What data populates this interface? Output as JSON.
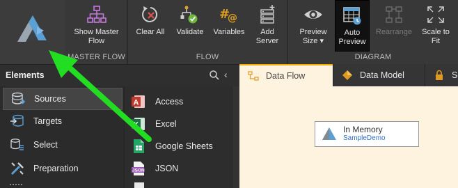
{
  "ribbon": {
    "master_flow": {
      "label": "MASTER FLOW",
      "show_master_flow": "Show Master Flow"
    },
    "flow": {
      "label": "FLOW",
      "clear_all": "Clear All",
      "validate": "Validate",
      "variables": "Variables",
      "add_server": "Add Server"
    },
    "diagram": {
      "label": "DIAGRAM",
      "preview_size": "Preview Size ▾",
      "auto_preview": "Auto Preview",
      "rearrange": "Rearrange",
      "scale_to_fit": "Scale to Fit"
    }
  },
  "elements_panel": {
    "title": "Elements",
    "categories": [
      {
        "label": "Sources",
        "icon": "database-icon",
        "selected": true
      },
      {
        "label": "Targets",
        "icon": "targets-icon"
      },
      {
        "label": "Select",
        "icon": "select-icon"
      },
      {
        "label": "Preparation",
        "icon": "preparation-icon"
      }
    ],
    "items": [
      {
        "label": "Access",
        "icon": "access-icon"
      },
      {
        "label": "Excel",
        "icon": "excel-icon"
      },
      {
        "label": "Google Sheets",
        "icon": "google-sheets-icon"
      },
      {
        "label": "JSON",
        "icon": "json-icon",
        "badge": "JSON"
      }
    ]
  },
  "tabs": [
    {
      "label": "Data Flow",
      "active": true
    },
    {
      "label": "Data Model"
    },
    {
      "label": "Se"
    }
  ],
  "canvas": {
    "node": {
      "title": "In Memory",
      "subtitle": "SampleDemo"
    }
  },
  "colors": {
    "accent": "#f2a900",
    "annotation_arrow": "#22dd22",
    "canvas_bg": "#fdf3de",
    "link": "#2a6fc9"
  }
}
